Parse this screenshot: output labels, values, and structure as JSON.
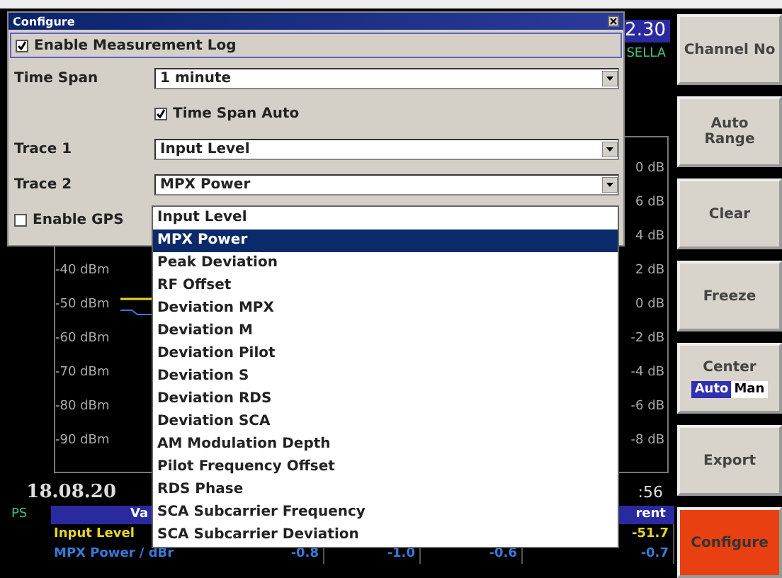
{
  "header": {
    "time": "2.30",
    "station": "SELLA"
  },
  "graph": {
    "left_labels": [
      "-40 dBm",
      "-50 dBm",
      "-60 dBm",
      "-70 dBm",
      "-80 dBm",
      "-90 dBm"
    ],
    "right_labels": [
      "0 dB",
      "6 dB",
      "4 dB",
      "2 dB",
      "0 dB",
      "-2 dB",
      "-4 dB",
      "-6 dB",
      "-8 dB"
    ]
  },
  "timestamp": {
    "date": "18.08.20",
    "time": ":56"
  },
  "table": {
    "side_label": "PS",
    "header": [
      "Va",
      "rent"
    ],
    "rows": [
      {
        "label": "Input Level",
        "color": "#e8d820",
        "values": [
          "-51.7"
        ]
      },
      {
        "label": "MPX Power / dBr",
        "color": "#3a7ad8",
        "values": [
          "-0.8",
          "-1.0",
          "-0.6",
          "-0.7"
        ]
      }
    ]
  },
  "dialog": {
    "title": "Configure",
    "fields": [
      {
        "kind": "wide_checkbox",
        "label": "Enable Measurement Log",
        "checked": true
      },
      {
        "kind": "select",
        "label": "Time Span",
        "value": "1 minute"
      },
      {
        "kind": "checkbox",
        "label": "Time Span Auto",
        "checked": true
      },
      {
        "kind": "select",
        "label": "Trace 1",
        "value": "Input Level"
      },
      {
        "kind": "select",
        "label": "Trace 2",
        "value": "MPX Power"
      },
      {
        "kind": "left_checkbox",
        "label": "Enable GPS",
        "checked": false
      }
    ]
  },
  "dropdown": {
    "items": [
      {
        "label": "Input Level",
        "selected": false
      },
      {
        "label": "MPX Power",
        "selected": true
      },
      {
        "label": "Peak Deviation",
        "selected": false
      },
      {
        "label": "RF Offset",
        "selected": false
      },
      {
        "label": "Deviation MPX",
        "selected": false
      },
      {
        "label": "Deviation M",
        "selected": false
      },
      {
        "label": "Deviation Pilot",
        "selected": false
      },
      {
        "label": "Deviation S",
        "selected": false
      },
      {
        "label": "Deviation RDS",
        "selected": false
      },
      {
        "label": "Deviation SCA",
        "selected": false
      },
      {
        "label": "AM Modulation Depth",
        "selected": false
      },
      {
        "label": "Pilot Frequency Offset",
        "selected": false
      },
      {
        "label": "RDS Phase",
        "selected": false
      },
      {
        "label": "SCA Subcarrier Frequency",
        "selected": false
      },
      {
        "label": "SCA Subcarrier Deviation",
        "selected": false
      }
    ]
  },
  "softkeys": [
    {
      "kind": "button",
      "label": "Channel No",
      "selected": false
    },
    {
      "kind": "button",
      "label": "Auto Range",
      "selected": false
    },
    {
      "kind": "button",
      "label": "Clear",
      "selected": false
    },
    {
      "kind": "button",
      "label": "Freeze",
      "selected": false
    },
    {
      "kind": "toggle",
      "label": "Center",
      "options": [
        {
          "label": "Auto",
          "selected": true
        },
        {
          "label": "Man",
          "selected": false
        }
      ]
    },
    {
      "kind": "button",
      "label": "Export",
      "selected": false
    },
    {
      "kind": "button",
      "label": "Configure",
      "selected": true
    }
  ]
}
